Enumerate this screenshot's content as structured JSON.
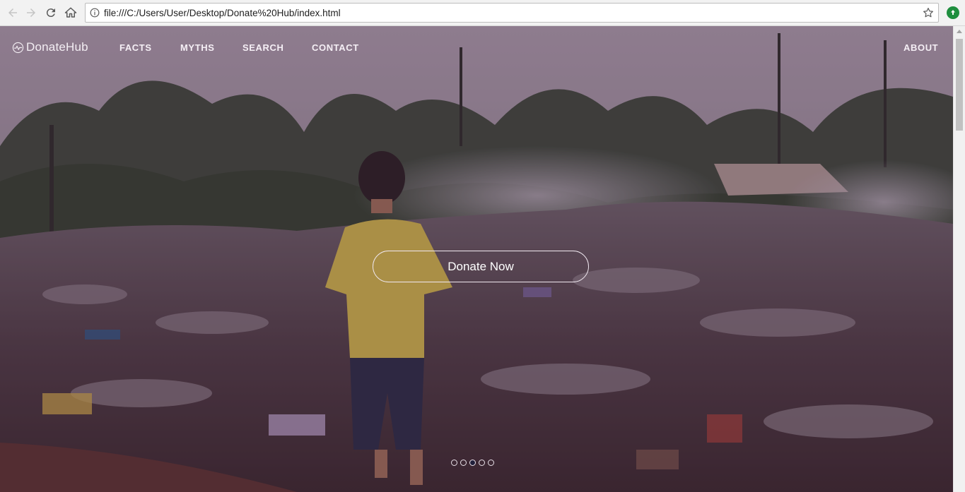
{
  "browser": {
    "url": "file:///C:/Users/User/Desktop/Donate%20Hub/index.html",
    "icons": [
      "back-icon",
      "forward-icon",
      "reload-icon",
      "home-icon",
      "info-icon",
      "star-icon",
      "extension-icon"
    ]
  },
  "site": {
    "brand": "DonateHub",
    "nav": {
      "facts": "FACTS",
      "myths": "MYTHS",
      "search": "SEARCH",
      "contact": "CONTACT",
      "about": "ABOUT"
    },
    "hero": {
      "button_label": "Donate Now",
      "slide_count": 5,
      "active_slide": 3
    }
  },
  "colors": {
    "nav_text": "#f5eff5",
    "overlay": "#3c143c",
    "active_dot": "#1f1f3a"
  }
}
